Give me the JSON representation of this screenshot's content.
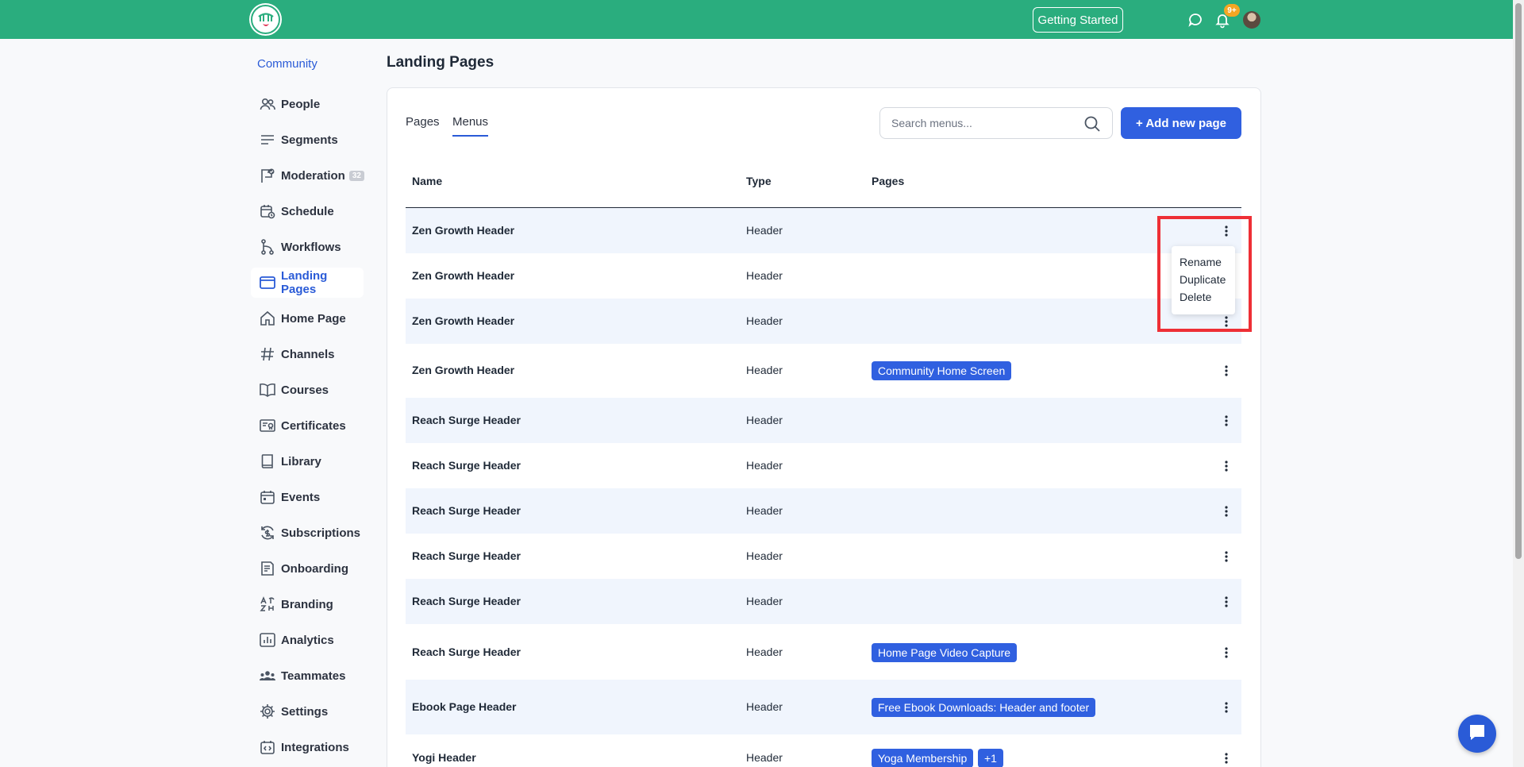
{
  "topbar": {
    "getting_started_label": "Getting Started",
    "notification_count": "9+"
  },
  "sidebar": {
    "community_label": "Community",
    "items": [
      {
        "label": "People",
        "icon": "people-icon"
      },
      {
        "label": "Segments",
        "icon": "segments-icon"
      },
      {
        "label": "Moderation",
        "icon": "moderation-icon",
        "badge": "32"
      },
      {
        "label": "Schedule",
        "icon": "schedule-icon"
      },
      {
        "label": "Workflows",
        "icon": "workflows-icon"
      },
      {
        "label": "Landing Pages",
        "icon": "landing-pages-icon",
        "active": true
      },
      {
        "label": "Home Page",
        "icon": "home-icon"
      },
      {
        "label": "Channels",
        "icon": "hash-icon"
      },
      {
        "label": "Courses",
        "icon": "book-open-icon"
      },
      {
        "label": "Certificates",
        "icon": "certificate-icon"
      },
      {
        "label": "Library",
        "icon": "library-icon"
      },
      {
        "label": "Events",
        "icon": "calendar-icon"
      },
      {
        "label": "Subscriptions",
        "icon": "subscriptions-icon"
      },
      {
        "label": "Onboarding",
        "icon": "onboarding-icon"
      },
      {
        "label": "Branding",
        "icon": "branding-icon"
      },
      {
        "label": "Analytics",
        "icon": "analytics-icon"
      },
      {
        "label": "Teammates",
        "icon": "teammates-icon"
      },
      {
        "label": "Settings",
        "icon": "gear-icon"
      },
      {
        "label": "Integrations",
        "icon": "integrations-icon"
      }
    ]
  },
  "main": {
    "page_title": "Landing Pages",
    "tabs": [
      {
        "label": "Pages",
        "active": false
      },
      {
        "label": "Menus",
        "active": true
      }
    ],
    "search_placeholder": "Search menus...",
    "add_button_label": "+ Add new page",
    "columns": [
      "Name",
      "Type",
      "Pages"
    ],
    "rows": [
      {
        "name": "Zen Growth Header",
        "type": "Header",
        "pages": []
      },
      {
        "name": "Zen Growth Header",
        "type": "Header",
        "pages": []
      },
      {
        "name": "Zen Growth Header",
        "type": "Header",
        "pages": []
      },
      {
        "name": "Zen Growth Header",
        "type": "Header",
        "pages": [
          "Community Home Screen"
        ]
      },
      {
        "name": "Reach Surge Header",
        "type": "Header",
        "pages": []
      },
      {
        "name": "Reach Surge Header",
        "type": "Header",
        "pages": []
      },
      {
        "name": "Reach Surge Header",
        "type": "Header",
        "pages": []
      },
      {
        "name": "Reach Surge Header",
        "type": "Header",
        "pages": []
      },
      {
        "name": "Reach Surge Header",
        "type": "Header",
        "pages": []
      },
      {
        "name": "Reach Surge Header",
        "type": "Header",
        "pages": [
          "Home Page Video Capture"
        ]
      },
      {
        "name": "Ebook Page Header",
        "type": "Header",
        "pages": [
          "Free Ebook Downloads: Header and footer"
        ]
      },
      {
        "name": "Yogi Header",
        "type": "Header",
        "pages": [
          "Yoga Membership",
          "+1"
        ]
      }
    ],
    "row_menu": [
      "Rename",
      "Duplicate",
      "Delete"
    ]
  },
  "colors": {
    "topbar": "#2aad7e",
    "accent": "#3060e0",
    "highlight": "#ee2f36"
  }
}
